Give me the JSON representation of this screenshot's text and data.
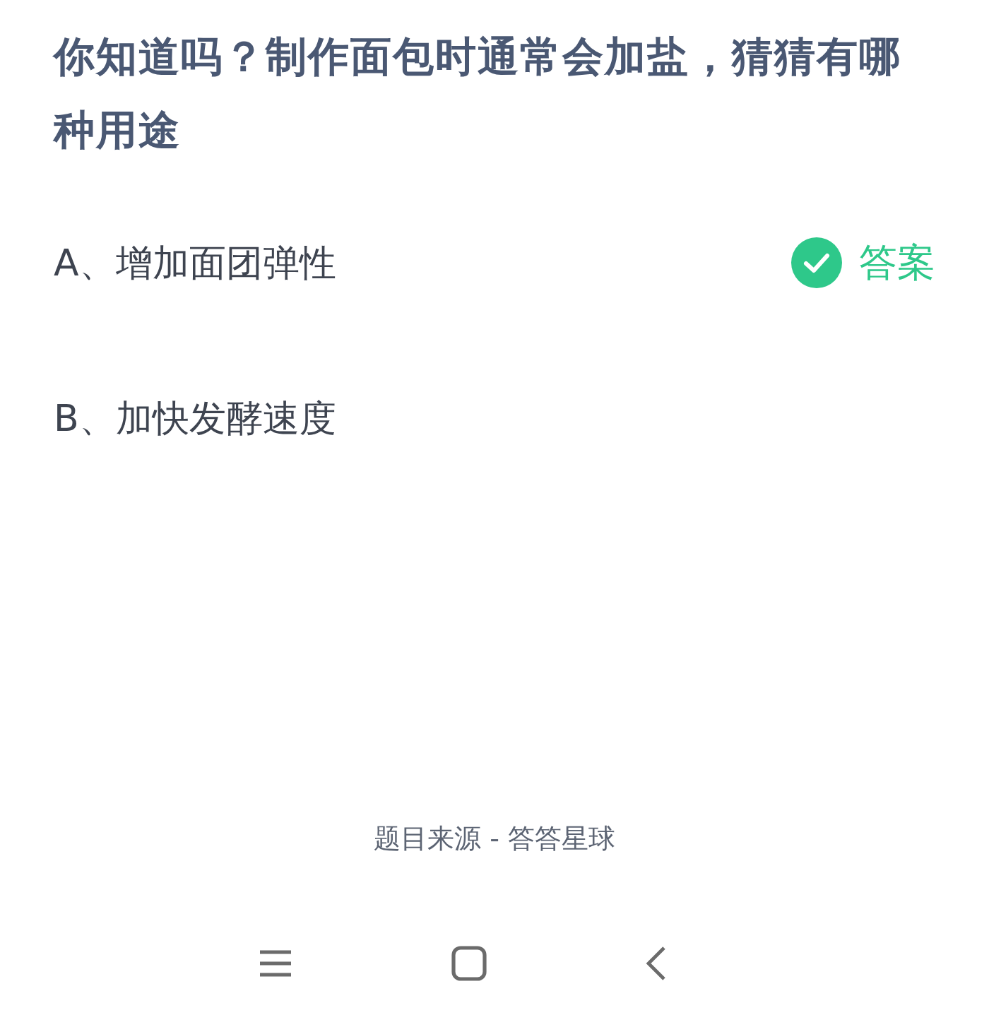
{
  "question": "你知道吗？制作面包时通常会加盐，猜猜有哪种用途",
  "options": [
    {
      "label": "A、增加面团弹性",
      "correct": true,
      "answer_label": "答案"
    },
    {
      "label": "B、加快发酵速度",
      "correct": false
    }
  ],
  "source": "题目来源 - 答答星球"
}
